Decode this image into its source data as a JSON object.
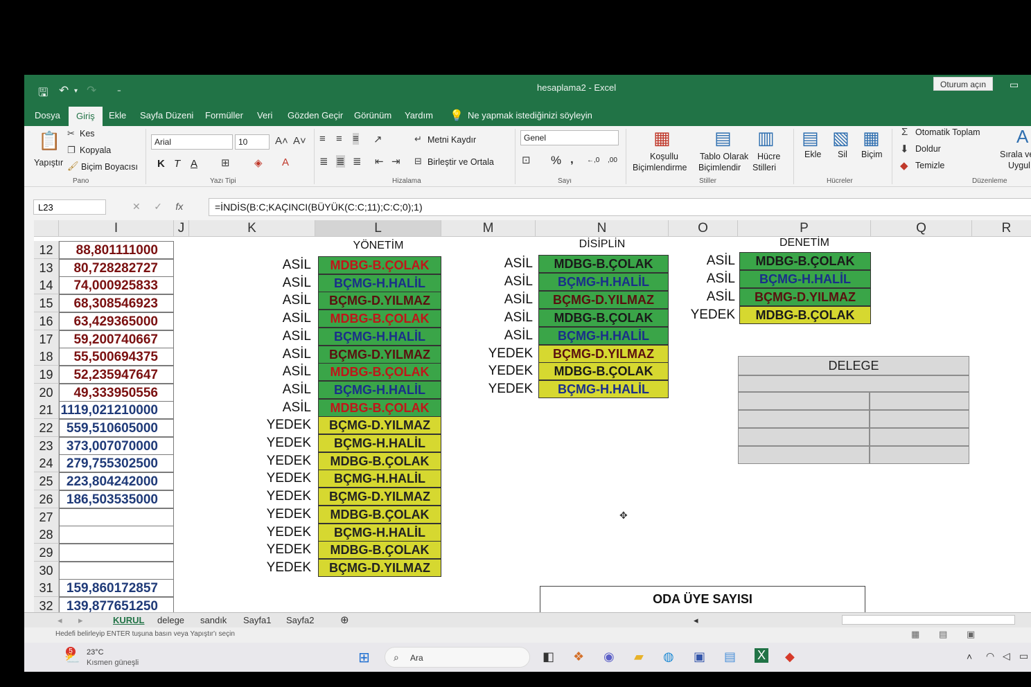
{
  "titlebar": {
    "title": "hesaplama2  -  Excel",
    "signin": "Oturum açın"
  },
  "tabs": [
    "Dosya",
    "Giriş",
    "Ekle",
    "Sayfa Düzeni",
    "Formüller",
    "Veri",
    "Gözden Geçir",
    "Görünüm",
    "Yardım"
  ],
  "tellme": "Ne yapmak istediğinizi söyleyin",
  "ribbon": {
    "paste": "Yapıştır",
    "cut": "Kes",
    "copy": "Kopyala",
    "format_painter": "Biçim Boyacısı",
    "group_clipboard": "Pano",
    "font_name": "Arial",
    "font_size": "10",
    "bold": "K",
    "italic": "T",
    "underline": "A",
    "group_font": "Yazı Tipi",
    "wrap_text": "Metni Kaydır",
    "merge_center": "Birleştir ve Ortala",
    "group_alignment": "Hizalama",
    "number_format": "Genel",
    "percent": "%",
    "comma": "‚",
    "inc_decimal": "←,0",
    "dec_decimal": ",00",
    "group_number": "Sayı",
    "cond_format_1": "Koşullu",
    "cond_format_2": "Biçimlendirme",
    "table_format_1": "Tablo Olarak",
    "table_format_2": "Biçimlendir",
    "cell_styles_1": "Hücre",
    "cell_styles_2": "Stilleri",
    "group_styles": "Stiller",
    "insert": "Ekle",
    "delete": "Sil",
    "format": "Biçim",
    "group_cells": "Hücreler",
    "autosum": "Otomatik Toplam",
    "fill": "Doldur",
    "clear": "Temizle",
    "sort_1": "Sırala ve",
    "sort_2": "Uygul",
    "group_editing": "Düzenleme"
  },
  "formula_bar": {
    "name_box": "L23",
    "formula": "=İNDİS(B:C;KAÇINCI(BÜYÜK(C:C;11);C:C;0);1)"
  },
  "columns": [
    "I",
    "J",
    "K",
    "L",
    "M",
    "N",
    "O",
    "P",
    "Q",
    "R"
  ],
  "rows": [
    {
      "n": "12",
      "i": "88,801111000",
      "ic": "#7a1010"
    },
    {
      "n": "13",
      "i": "80,728282727",
      "ic": "#7a1010"
    },
    {
      "n": "14",
      "i": "74,000925833",
      "ic": "#7a1010"
    },
    {
      "n": "15",
      "i": "68,308546923",
      "ic": "#7a1010"
    },
    {
      "n": "16",
      "i": "63,429365000",
      "ic": "#7a1010"
    },
    {
      "n": "17",
      "i": "59,200740667",
      "ic": "#7a1010"
    },
    {
      "n": "18",
      "i": "55,500694375",
      "ic": "#7a1010"
    },
    {
      "n": "19",
      "i": "52,235947647",
      "ic": "#7a1010"
    },
    {
      "n": "20",
      "i": "49,333950556",
      "ic": "#7a1010"
    },
    {
      "n": "21",
      "i": "1119,021210000",
      "ic": "#1f3a78"
    },
    {
      "n": "22",
      "i": "559,510605000",
      "ic": "#1f3a78"
    },
    {
      "n": "23",
      "i": "373,007070000",
      "ic": "#1f3a78"
    },
    {
      "n": "24",
      "i": "279,755302500",
      "ic": "#1f3a78"
    },
    {
      "n": "25",
      "i": "223,804242000",
      "ic": "#1f3a78"
    },
    {
      "n": "26",
      "i": "186,503535000",
      "ic": "#1f3a78"
    },
    {
      "n": "27",
      "i": "",
      "ic": "#1f3a78"
    },
    {
      "n": "28",
      "i": "",
      "ic": "#1f3a78"
    },
    {
      "n": "29",
      "i": "",
      "ic": "#1f3a78"
    },
    {
      "n": "30",
      "i": "",
      "ic": "#1f3a78"
    },
    {
      "n": "31",
      "i": "159,860172857",
      "ic": "#1f3a78"
    },
    {
      "n": "32",
      "i": "139,877651250",
      "ic": "#1f3a78"
    }
  ],
  "yonetim": {
    "header": "YÖNETİM",
    "items": [
      {
        "label": "ASİL",
        "value": "MDBG-B.ÇOLAK",
        "fill": "g",
        "color": "#c0161a"
      },
      {
        "label": "ASİL",
        "value": "BÇMG-H.HALİL",
        "fill": "g",
        "color": "#1a2f8a"
      },
      {
        "label": "ASİL",
        "value": "BÇMG-D.YILMAZ",
        "fill": "g",
        "color": "#5a1010"
      },
      {
        "label": "ASİL",
        "value": "MDBG-B.ÇOLAK",
        "fill": "g",
        "color": "#c0161a"
      },
      {
        "label": "ASİL",
        "value": "BÇMG-H.HALİL",
        "fill": "g",
        "color": "#1a2f8a"
      },
      {
        "label": "ASİL",
        "value": "BÇMG-D.YILMAZ",
        "fill": "g",
        "color": "#5a1010"
      },
      {
        "label": "ASİL",
        "value": "MDBG-B.ÇOLAK",
        "fill": "g",
        "color": "#c0161a"
      },
      {
        "label": "ASİL",
        "value": "BÇMG-H.HALİL",
        "fill": "g",
        "color": "#1a2f8a"
      },
      {
        "label": "ASİL",
        "value": "MDBG-B.ÇOLAK",
        "fill": "g",
        "color": "#c0161a"
      },
      {
        "label": "YEDEK",
        "value": "BÇMG-D.YILMAZ",
        "fill": "y",
        "color": "#222"
      },
      {
        "label": "YEDEK",
        "value": "BÇMG-H.HALİL",
        "fill": "y",
        "color": "#222"
      },
      {
        "label": "YEDEK",
        "value": "MDBG-B.ÇOLAK",
        "fill": "y",
        "color": "#222"
      },
      {
        "label": "YEDEK",
        "value": "BÇMG-H.HALİL",
        "fill": "y",
        "color": "#222"
      },
      {
        "label": "YEDEK",
        "value": "BÇMG-D.YILMAZ",
        "fill": "y",
        "color": "#222"
      },
      {
        "label": "YEDEK",
        "value": "MDBG-B.ÇOLAK",
        "fill": "y",
        "color": "#222"
      },
      {
        "label": "YEDEK",
        "value": "BÇMG-H.HALİL",
        "fill": "y",
        "color": "#222"
      },
      {
        "label": "YEDEK",
        "value": "MDBG-B.ÇOLAK",
        "fill": "y",
        "color": "#222"
      },
      {
        "label": "YEDEK",
        "value": "BÇMG-D.YILMAZ",
        "fill": "y",
        "color": "#222"
      }
    ]
  },
  "disiplin": {
    "header": "DİSİPLİN",
    "items": [
      {
        "label": "ASİL",
        "value": "MDBG-B.ÇOLAK",
        "fill": "g",
        "color": "#1a1a1a"
      },
      {
        "label": "ASİL",
        "value": "BÇMG-H.HALİL",
        "fill": "g",
        "color": "#1a2f8a"
      },
      {
        "label": "ASİL",
        "value": "BÇMG-D.YILMAZ",
        "fill": "g",
        "color": "#5a1010"
      },
      {
        "label": "ASİL",
        "value": "MDBG-B.ÇOLAK",
        "fill": "g",
        "color": "#1a1a1a"
      },
      {
        "label": "ASİL",
        "value": "BÇMG-H.HALİL",
        "fill": "g",
        "color": "#1a2f8a"
      },
      {
        "label": "YEDEK",
        "value": "BÇMG-D.YILMAZ",
        "fill": "y",
        "color": "#5a1010"
      },
      {
        "label": "YEDEK",
        "value": "MDBG-B.ÇOLAK",
        "fill": "y",
        "color": "#1a1a1a"
      },
      {
        "label": "YEDEK",
        "value": "BÇMG-H.HALİL",
        "fill": "y",
        "color": "#1a2f8a"
      }
    ]
  },
  "denetim": {
    "header": "DENETİM",
    "items": [
      {
        "label": "ASİL",
        "value": "MDBG-B.ÇOLAK",
        "fill": "g",
        "color": "#1a1a1a"
      },
      {
        "label": "ASİL",
        "value": "BÇMG-H.HALİL",
        "fill": "g",
        "color": "#1a2f8a"
      },
      {
        "label": "ASİL",
        "value": "BÇMG-D.YILMAZ",
        "fill": "g",
        "color": "#5a1010"
      },
      {
        "label": "YEDEK",
        "value": "MDBG-B.ÇOLAK",
        "fill": "y",
        "color": "#1a1a1a"
      }
    ]
  },
  "delege": "DELEGE",
  "oda_uye": "ODA ÜYE SAYISI",
  "sheets": [
    "KURUL",
    "delege",
    "sandık",
    "Sayfa1",
    "Sayfa2"
  ],
  "add_sheet": "⊕",
  "status_text": "Hedefi belirleyip ENTER tuşuna basın veya Yapıştır'ı seçin",
  "taskbar": {
    "weather_badge": "5",
    "temp": "23°C",
    "weather": "Kısmen güneşli",
    "search": "Ara"
  },
  "colors": {
    "excel_green": "#217346",
    "cell_green": "#3aa548",
    "cell_yellow": "#d6d830"
  }
}
